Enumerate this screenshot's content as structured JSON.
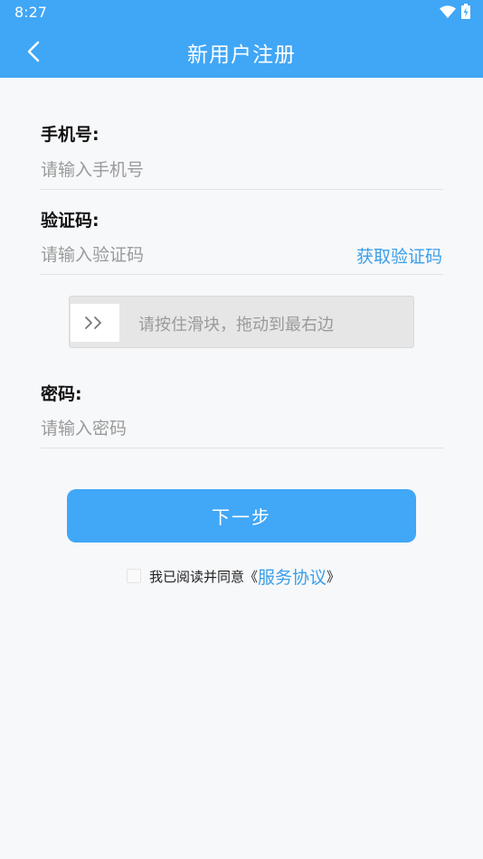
{
  "status_bar": {
    "time": "8:27"
  },
  "header": {
    "title": "新用户注册"
  },
  "form": {
    "phone": {
      "label": "手机号:",
      "placeholder": "请输入手机号",
      "value": ""
    },
    "code": {
      "label": "验证码:",
      "placeholder": "请输入验证码",
      "value": "",
      "get_code_label": "获取验证码"
    },
    "slider": {
      "text": "请按住滑块，拖动到最右边"
    },
    "password": {
      "label": "密码:",
      "placeholder": "请输入密码",
      "value": ""
    },
    "next_label": "下一步"
  },
  "agreement": {
    "text": "我已阅读并同意",
    "open_bracket": "《",
    "link": "服务协议",
    "close_bracket": "》",
    "checked": false
  },
  "colors": {
    "primary": "#40a6f6",
    "link": "#3b9fe8",
    "background": "#f7f8fa"
  },
  "icons": {
    "back": "chevron-left-icon",
    "wifi": "wifi-icon",
    "battery": "battery-charging-icon",
    "slider": "double-chevron-right-icon"
  }
}
